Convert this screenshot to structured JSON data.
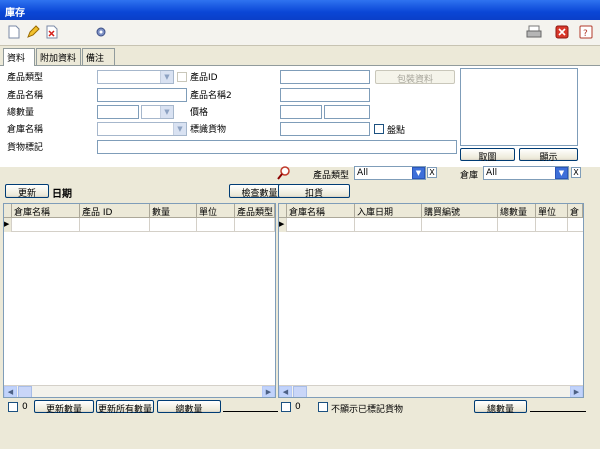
{
  "window": {
    "title": "庫存"
  },
  "tabs": [
    "資料",
    "附加資料",
    "備注"
  ],
  "form": {
    "product_type_label": "產品類型",
    "product_name_label": "產品名稱",
    "total_qty_label": "總數量",
    "warehouse_label": "倉庫名稱",
    "cargo_mark_label": "貨物標記",
    "product_id_label": "產品ID",
    "product_name2_label": "產品名稱2",
    "price_label": "價格",
    "mark_cargo_label": "標識貨物",
    "package_btn": "包裝資料",
    "stocktake_label": "盤點",
    "fetch_image_btn": "取圖",
    "show_btn": "顯示"
  },
  "filter": {
    "product_type_label": "產品類型",
    "product_type_value": "All",
    "warehouse_label": "倉庫",
    "warehouse_value": "All",
    "clear_glyph": "X"
  },
  "actions": {
    "refresh_btn": "更新",
    "date_label": "日期",
    "check_qty_btn": "檢查數量",
    "deduct_btn": "扣貨"
  },
  "left_grid": {
    "columns": [
      "倉庫名稱",
      "產品 ID",
      "數量",
      "單位",
      "產品類型"
    ],
    "row_marker": "▶"
  },
  "right_grid": {
    "columns": [
      "倉庫名稱",
      "入庫日期",
      "購買編號",
      "總數量",
      "單位",
      "倉"
    ],
    "row_marker": "▶"
  },
  "bottom": {
    "left_count": "0",
    "update_qty_btn": "更新數量",
    "update_all_btn": "更新所有數量",
    "total_qty_btn": "總數量",
    "right_count": "0",
    "hide_marked_label": "不顯示已標記貨物",
    "right_total_btn": "總數量"
  }
}
